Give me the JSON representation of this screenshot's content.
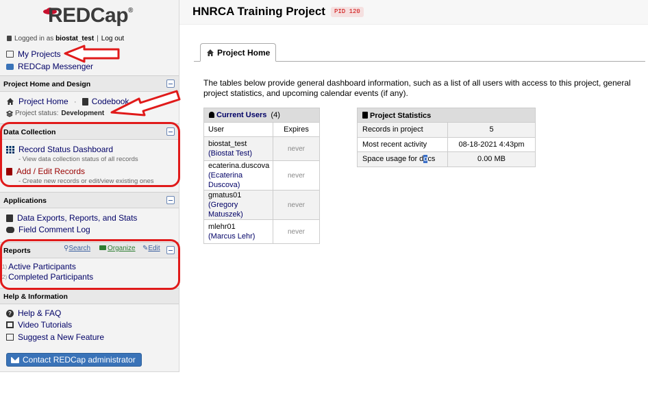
{
  "sidebar": {
    "logo_text": "REDCap",
    "logo_mark": "®",
    "logged_in_prefix": "Logged in as",
    "username": "biostat_test",
    "separator": "|",
    "logout": "Log out",
    "my_projects": "My Projects",
    "messenger": "REDCap Messenger",
    "sections": {
      "home_design": {
        "title": "Project Home and Design",
        "project_home": "Project Home",
        "dot": "·",
        "codebook": "Codebook",
        "status_label": "Project status:",
        "status_value": "Development"
      },
      "data_collection": {
        "title": "Data Collection",
        "record_status": "Record Status Dashboard",
        "record_status_sub": "- View data collection status of all records",
        "add_edit": "Add / Edit Records",
        "add_edit_sub": "- Create new records or edit/view existing ones"
      },
      "applications": {
        "title": "Applications",
        "exports": "Data Exports, Reports, and Stats",
        "comment_log": "Field Comment Log"
      },
      "reports": {
        "title": "Reports",
        "search": "Search",
        "organize": "Organize",
        "edit": "Edit",
        "items": [
          {
            "num": "1)",
            "label": "Active Participants"
          },
          {
            "num": "2)",
            "label": "Completed Participants"
          }
        ]
      },
      "help": {
        "title": "Help & Information",
        "faq": "Help & FAQ",
        "videos": "Video Tutorials",
        "suggest": "Suggest a New Feature",
        "contact": "Contact REDCap administrator"
      }
    }
  },
  "header": {
    "project_title": "HNRCA Training Project",
    "pid": "PID 120"
  },
  "main": {
    "tab": "Project Home",
    "intro": "The tables below provide general dashboard information, such as a list of all users with access to this project, general project statistics, and upcoming calendar events (if any).",
    "users": {
      "title": "Current Users",
      "count": "(4)",
      "col_user": "User",
      "col_expires": "Expires",
      "rows": [
        {
          "username": "biostat_test",
          "fullname": "(Biostat Test)",
          "expires": "never"
        },
        {
          "username": "ecaterina.duscova",
          "fullname": "(Ecaterina Duscova)",
          "expires": "never"
        },
        {
          "username": "gmatus01",
          "fullname": "(Gregory Matuszek)",
          "expires": "never"
        },
        {
          "username": "mlehr01",
          "fullname": "(Marcus Lehr)",
          "expires": "never"
        }
      ]
    },
    "stats": {
      "title": "Project Statistics",
      "rows": [
        {
          "label": "Records in project",
          "value": "5"
        },
        {
          "label": "Most recent activity",
          "value": "08-18-2021 4:43pm"
        },
        {
          "label_pre": "Space usage for d",
          "label_hl": "o",
          "label_post": "cs",
          "value": "0.00 MB"
        }
      ]
    }
  },
  "colors": {
    "link": "#000066",
    "accent_red": "#990000",
    "annotation_red": "#e01a1a",
    "button_blue": "#3a73b8"
  }
}
